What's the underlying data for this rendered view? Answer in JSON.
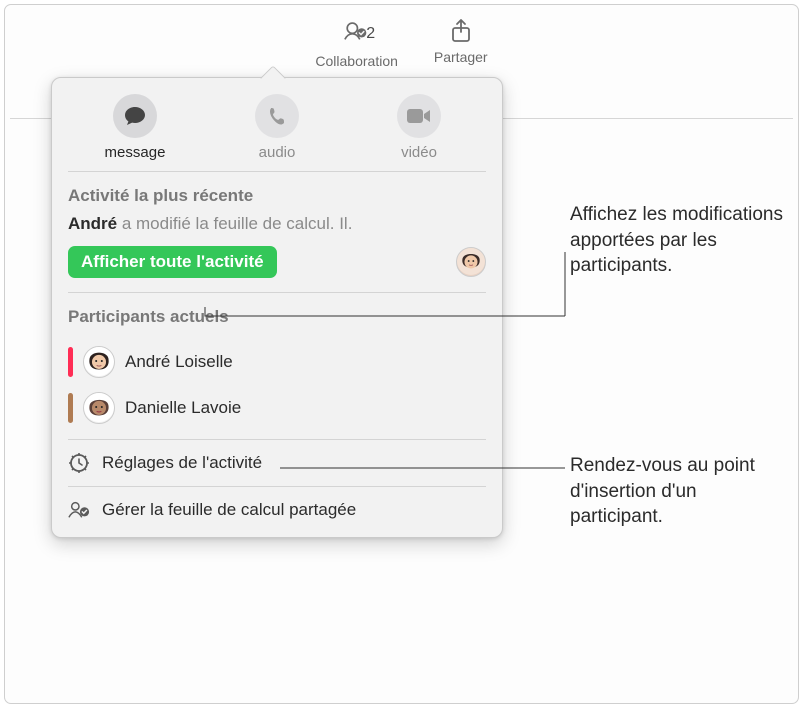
{
  "toolbar": {
    "collaboration": {
      "label": "Collaboration",
      "count": "2"
    },
    "share": {
      "label": "Partager"
    }
  },
  "popover": {
    "comm": {
      "message": "message",
      "audio": "audio",
      "video": "vidéo"
    },
    "recent": {
      "title": "Activité la plus récente",
      "who": "André",
      "what": " a modifié la feuille de calcul. Il.",
      "showAll": "Afficher toute l'activité"
    },
    "participants": {
      "title": "Participants actuels",
      "list": [
        {
          "name": "André Loiselle",
          "color": "#ff2d55"
        },
        {
          "name": "Danielle Lavoie",
          "color": "#af7b52"
        }
      ]
    },
    "footer": {
      "settings": "Réglages de l'activité",
      "manage": "Gérer la feuille de calcul partagée"
    }
  },
  "callouts": {
    "c1": "Affichez les modifications apportées par les participants.",
    "c2": "Rendez-vous au point d'insertion d'un participant."
  }
}
